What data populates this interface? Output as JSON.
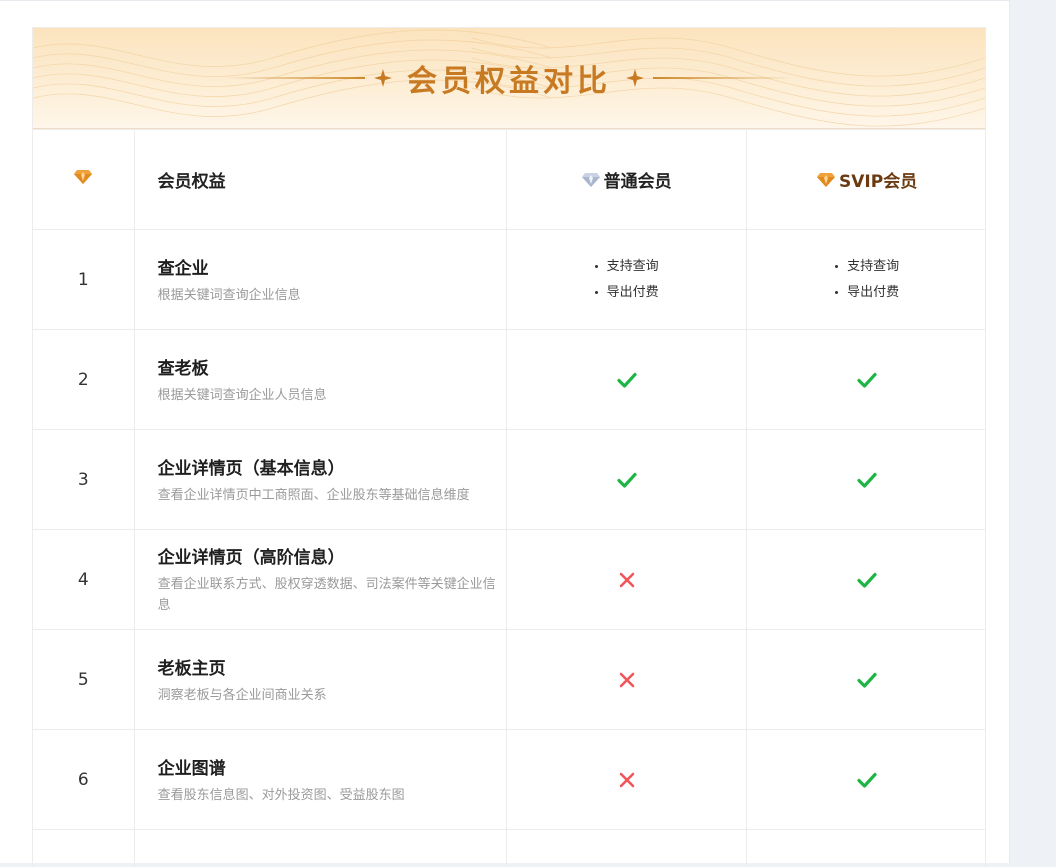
{
  "banner": {
    "title": "会员权益对比"
  },
  "header": {
    "feature_col": "会员权益",
    "plans": [
      {
        "key": "normal",
        "label": "普通会员",
        "icon": "diamond-silver-icon",
        "color": "#b9c6dc"
      },
      {
        "key": "svip",
        "label": "SVIP会员",
        "icon": "diamond-gold-icon",
        "color": "#f0a23a"
      }
    ]
  },
  "colors": {
    "accent_gold": "#c77a22",
    "check_green": "#1fb546",
    "cross_red": "#f2555a"
  },
  "rows": [
    {
      "num": "1",
      "title": "查企业",
      "desc": "根据关键词查询企业信息",
      "normal": {
        "type": "list",
        "items": [
          "支持查询",
          "导出付费"
        ]
      },
      "svip": {
        "type": "list",
        "items": [
          "支持查询",
          "导出付费"
        ]
      }
    },
    {
      "num": "2",
      "title": "查老板",
      "desc": "根据关键词查询企业人员信息",
      "normal": {
        "type": "check"
      },
      "svip": {
        "type": "check"
      }
    },
    {
      "num": "3",
      "title": "企业详情页（基本信息）",
      "desc": "查看企业详情页中工商照面、企业股东等基础信息维度",
      "normal": {
        "type": "check"
      },
      "svip": {
        "type": "check"
      }
    },
    {
      "num": "4",
      "title": "企业详情页（高阶信息）",
      "desc": "查看企业联系方式、股权穿透数据、司法案件等关键企业信息",
      "normal": {
        "type": "cross"
      },
      "svip": {
        "type": "check"
      }
    },
    {
      "num": "5",
      "title": "老板主页",
      "desc": "洞察老板与各企业间商业关系",
      "normal": {
        "type": "cross"
      },
      "svip": {
        "type": "check"
      }
    },
    {
      "num": "6",
      "title": "企业图谱",
      "desc": "查看股东信息图、对外投资图、受益股东图",
      "normal": {
        "type": "cross"
      },
      "svip": {
        "type": "check"
      }
    },
    {
      "num": "",
      "title": "",
      "desc": "",
      "normal": {
        "type": "none"
      },
      "svip": {
        "type": "none"
      }
    }
  ]
}
